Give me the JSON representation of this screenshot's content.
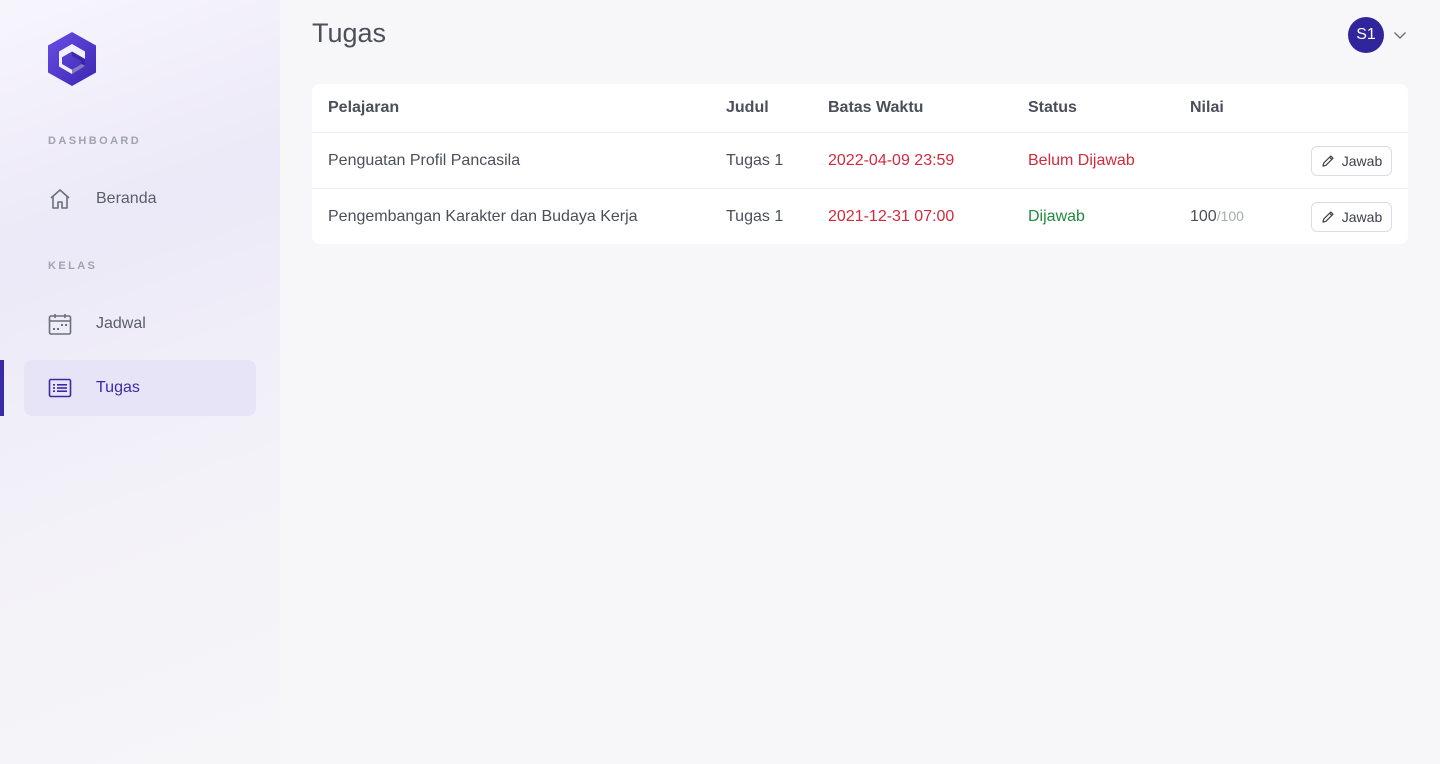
{
  "sidebar": {
    "sections": [
      {
        "label": "DASHBOARD"
      },
      {
        "label": "KELAS"
      }
    ],
    "items": [
      {
        "label": "Beranda",
        "icon": "home-icon"
      },
      {
        "label": "Jadwal",
        "icon": "calendar-icon"
      },
      {
        "label": "Tugas",
        "icon": "list-icon",
        "active": true
      }
    ]
  },
  "header": {
    "title": "Tugas",
    "user": {
      "initials": "S1"
    }
  },
  "table": {
    "columns": [
      "Pelajaran",
      "Judul",
      "Batas Waktu",
      "Status",
      "Nilai"
    ],
    "rows": [
      {
        "pelajaran": "Penguatan Profil Pancasila",
        "judul": "Tugas 1",
        "batas_waktu": "2022-04-09 23:59",
        "status": "Belum Dijawab",
        "nilai": "",
        "nilai_max": "",
        "action": "Jawab"
      },
      {
        "pelajaran": "Pengembangan Karakter dan Budaya Kerja",
        "judul": "Tugas 1",
        "batas_waktu": "2021-12-31 07:00",
        "status": "Dijawab",
        "nilai": "100",
        "nilai_max": "/100",
        "action": "Jawab"
      }
    ]
  },
  "colors": {
    "accent": "#3a2aa8",
    "deadline": "#d12a3c",
    "status_pending": "#d12a3c",
    "status_done": "#1f8a3e"
  }
}
